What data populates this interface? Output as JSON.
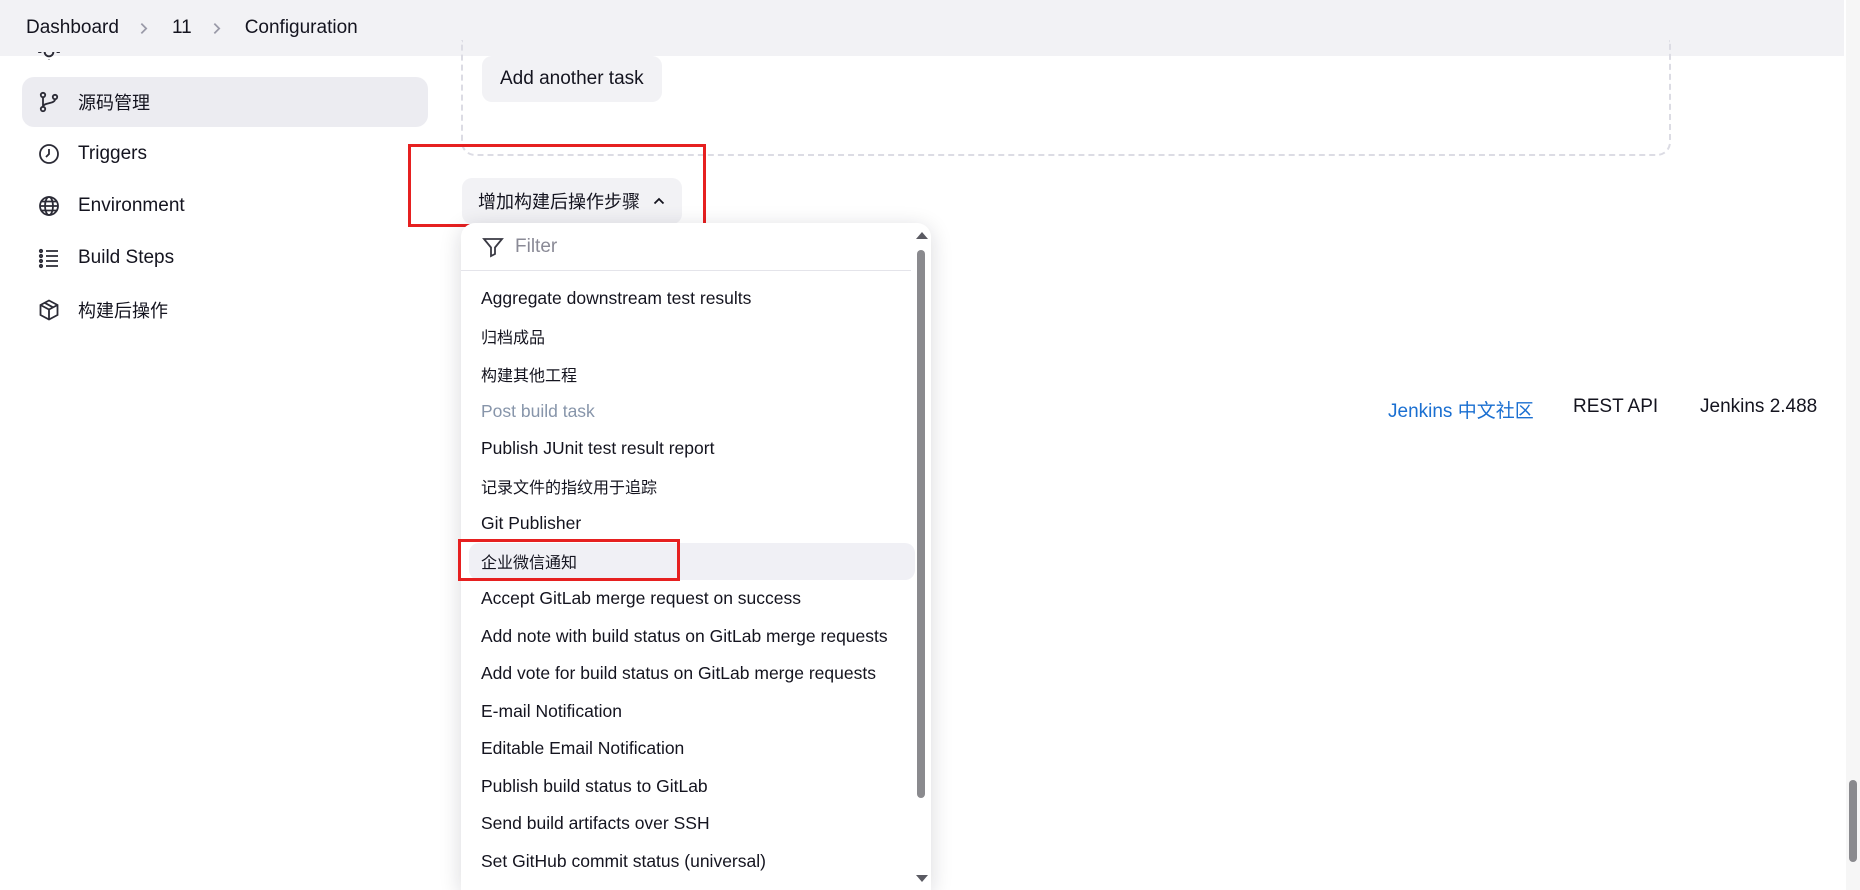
{
  "breadcrumb": {
    "items": [
      "Dashboard",
      "11",
      "Configuration"
    ]
  },
  "sidebar": {
    "items": [
      {
        "label": "源码管理",
        "icon": "git-branch-icon",
        "active": true
      },
      {
        "label": "Triggers",
        "icon": "clock-icon",
        "active": false
      },
      {
        "label": "Environment",
        "icon": "globe-icon",
        "active": false
      },
      {
        "label": "Build Steps",
        "icon": "list-icon",
        "active": false
      },
      {
        "label": "构建后操作",
        "icon": "cube-icon",
        "active": false
      }
    ]
  },
  "main": {
    "add_task_label": "Add another task",
    "post_build_button_label": "增加构建后操作步骤"
  },
  "dropdown": {
    "filter_placeholder": "Filter",
    "items": [
      {
        "label": "Aggregate downstream test results",
        "disabled": false,
        "highlighted": false
      },
      {
        "label": "归档成品",
        "disabled": false,
        "highlighted": false
      },
      {
        "label": "构建其他工程",
        "disabled": false,
        "highlighted": false
      },
      {
        "label": "Post build task",
        "disabled": true,
        "highlighted": false
      },
      {
        "label": "Publish JUnit test result report",
        "disabled": false,
        "highlighted": false
      },
      {
        "label": "记录文件的指纹用于追踪",
        "disabled": false,
        "highlighted": false
      },
      {
        "label": "Git Publisher",
        "disabled": false,
        "highlighted": false
      },
      {
        "label": "企业微信通知",
        "disabled": false,
        "highlighted": true
      },
      {
        "label": "Accept GitLab merge request on success",
        "disabled": false,
        "highlighted": false
      },
      {
        "label": "Add note with build status on GitLab merge requests",
        "disabled": false,
        "highlighted": false
      },
      {
        "label": "Add vote for build status on GitLab merge requests",
        "disabled": false,
        "highlighted": false
      },
      {
        "label": "E-mail Notification",
        "disabled": false,
        "highlighted": false
      },
      {
        "label": "Editable Email Notification",
        "disabled": false,
        "highlighted": false
      },
      {
        "label": "Publish build status to GitLab",
        "disabled": false,
        "highlighted": false
      },
      {
        "label": "Send build artifacts over SSH",
        "disabled": false,
        "highlighted": false
      },
      {
        "label": "Set GitHub commit status (universal)",
        "disabled": false,
        "highlighted": false
      }
    ]
  },
  "footer": {
    "community_link": "Jenkins 中文社区",
    "rest_api": "REST API",
    "version": "Jenkins 2.488"
  },
  "colors": {
    "link": "#1a6fd1",
    "annotation_red": "#e62020",
    "disabled_text": "#8795aa",
    "active_bg": "#ececf1"
  }
}
